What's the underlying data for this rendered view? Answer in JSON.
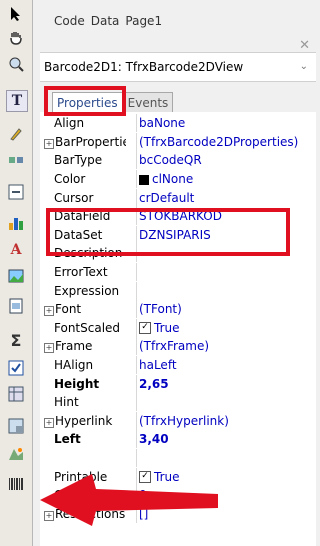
{
  "top_tabs": [
    "Code",
    "Data",
    "Page1"
  ],
  "object_selector": "Barcode2D1: TfrxBarcode2DView",
  "inspector_tabs": {
    "properties": "Properties",
    "events": "Events"
  },
  "properties": [
    {
      "name": "Align",
      "value": "baNone"
    },
    {
      "name": "BarProperties",
      "value": "(TfrxBarcode2DProperties)",
      "expand": true
    },
    {
      "name": "BarType",
      "value": "bcCodeQR"
    },
    {
      "name": "Color",
      "value": "clNone"
    },
    {
      "name": "Cursor",
      "value": "crDefault"
    },
    {
      "name": "DataField",
      "value": "STOKBARKOD"
    },
    {
      "name": "DataSet",
      "value": "DZNSIPARIS"
    },
    {
      "name": "Description",
      "value": ""
    },
    {
      "name": "ErrorText",
      "value": ""
    },
    {
      "name": "Expression",
      "value": ""
    },
    {
      "name": "Font",
      "value": "(TFont)",
      "expand": true
    },
    {
      "name": "FontScaled",
      "value": "True"
    },
    {
      "name": "Frame",
      "value": "(TfrxFrame)",
      "expand": true
    },
    {
      "name": "HAlign",
      "value": "haLeft"
    },
    {
      "name": "Height",
      "value": "2,65",
      "bold": true
    },
    {
      "name": "Hint",
      "value": ""
    },
    {
      "name": "Hyperlink",
      "value": "(TfrxHyperlink)",
      "expand": true
    },
    {
      "name": "Left",
      "value": "3,40",
      "bold": true
    },
    {
      "name": "",
      "value": ""
    },
    {
      "name": "Printable",
      "value": "True"
    },
    {
      "name": "QuietZone",
      "value": "0"
    },
    {
      "name": "Restrictions",
      "value": "[]",
      "expand": true
    }
  ],
  "colors": {
    "highlight": "#e01020",
    "value_text": "#0000c0"
  }
}
